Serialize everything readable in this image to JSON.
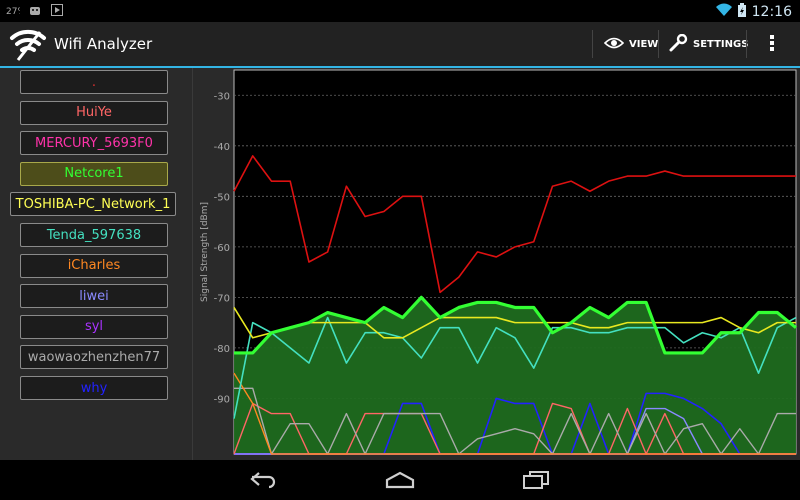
{
  "status_bar": {
    "icons": [
      "notification-icon",
      "android-icon",
      "play-icon"
    ],
    "time": "12:16"
  },
  "app": {
    "title": "Wifi Analyzer",
    "view_label": "VIEW",
    "settings_label": "SETTINGS"
  },
  "colors": {
    "accent": "#33b5e5",
    "selected_ap": "#4d4d1a"
  },
  "access_points": [
    {
      "name": ".",
      "color": "#e03030"
    },
    {
      "name": "HuiYe",
      "color": "#ff6666"
    },
    {
      "name": "MERCURY_5693F0",
      "color": "#ff33aa"
    },
    {
      "name": "Netcore1",
      "color": "#33ff33",
      "selected": true
    },
    {
      "name": "TOSHIBA-PC_Network_1",
      "color": "#ffff55"
    },
    {
      "name": "Tenda_597638",
      "color": "#44e0c0"
    },
    {
      "name": "iCharles",
      "color": "#ff8822"
    },
    {
      "name": "liwei",
      "color": "#8a8aff"
    },
    {
      "name": "syl",
      "color": "#aa33ff"
    },
    {
      "name": "waowaozhenzhen77",
      "color": "#aaaaaa"
    },
    {
      "name": "why",
      "color": "#2222ff"
    }
  ],
  "chart_data": {
    "type": "line",
    "ylabel": "Signal Strength [dBm]",
    "ylim": [
      -101,
      -25
    ],
    "yticks": [
      -30,
      -40,
      -50,
      -60,
      -70,
      -80,
      -90
    ],
    "ytick_labels": [
      "-30",
      "-40",
      "-50",
      "-60",
      "-70",
      "-80",
      "-90"
    ],
    "x": [
      0,
      1,
      2,
      3,
      4,
      5,
      6,
      7,
      8,
      9,
      10,
      11,
      12,
      13,
      14,
      15,
      16,
      17,
      18,
      19,
      20,
      21,
      22,
      23,
      24,
      25,
      26,
      27,
      28,
      29,
      30
    ],
    "series": [
      {
        "name": ".",
        "color": "#dd1111",
        "width": 1.6,
        "fill": false,
        "values": [
          -49,
          -42,
          -47,
          -47,
          -63,
          -61,
          -48,
          -54,
          -53,
          -50,
          -50,
          -69,
          -66,
          -61,
          -62,
          -60,
          -59,
          -48,
          -47,
          -49,
          -47,
          -46,
          -46,
          -45,
          -46,
          -46,
          -46,
          -46,
          -46,
          -46,
          -46
        ]
      },
      {
        "name": "Netcore1",
        "color": "#33ff33",
        "width": 3.2,
        "fill": true,
        "values": [
          -81,
          -81,
          -77,
          -76,
          -75,
          -73,
          -74,
          -75,
          -72,
          -74,
          -70,
          -74,
          -72,
          -71,
          -71,
          -72,
          -72,
          -77,
          -75,
          -72,
          -74,
          -71,
          -71,
          -81,
          -81,
          -81,
          -77,
          -77,
          -73,
          -73,
          -76
        ]
      },
      {
        "name": "TOSHIBA-PC_Network_1",
        "color": "#e8e820",
        "width": 1.6,
        "fill": false,
        "values": [
          -72,
          -78,
          -77,
          -76,
          -75,
          -75,
          -75,
          -75,
          -78,
          -78,
          -76,
          -74,
          -74,
          -74,
          -74,
          -75,
          -75,
          -75,
          -75,
          -76,
          -76,
          -75,
          -75,
          -75,
          -75,
          -75,
          -74,
          -76,
          -77,
          -75,
          -75
        ]
      },
      {
        "name": "Tenda_597638",
        "color": "#44e0c0",
        "width": 1.6,
        "fill": false,
        "values": [
          -94,
          -75,
          -77,
          -80,
          -83,
          -74,
          -83,
          -77,
          -77,
          -78,
          -82,
          -76,
          -76,
          -83,
          -76,
          -78,
          -84,
          -76,
          -76,
          -77,
          -77,
          -76,
          -76,
          -76,
          -79,
          -77,
          -78,
          -76,
          -85,
          -76,
          -74
        ]
      },
      {
        "name": "iCharles",
        "color": "#ff8822",
        "width": 1.4,
        "fill": false,
        "values": [
          -85,
          -91,
          -101,
          -101,
          -101,
          -101,
          -101,
          -101,
          -101,
          -101,
          -101,
          -101,
          -101,
          -101,
          -101,
          -101,
          -101,
          -101,
          -101,
          -101,
          -101,
          -101,
          -101,
          -101,
          -101,
          -101,
          -101,
          -101,
          -101,
          -101,
          -101
        ]
      },
      {
        "name": "waowaozhenzhen77",
        "color": "#aaaaaa",
        "width": 1.4,
        "fill": false,
        "values": [
          -88,
          -88,
          -101,
          -95,
          -95,
          -101,
          -93,
          -101,
          -93,
          -93,
          -93,
          -93,
          -101,
          -98,
          -97,
          -96,
          -97,
          -101,
          -93,
          -101,
          -93,
          -101,
          -93,
          -101,
          -96,
          -95,
          -101,
          -96,
          -101,
          -93,
          -93
        ]
      },
      {
        "name": "HuiYe",
        "color": "#ff6666",
        "width": 1.4,
        "fill": false,
        "values": [
          -101,
          -91,
          -93,
          -93,
          -101,
          -101,
          -101,
          -93,
          -93,
          -93,
          -93,
          -101,
          -101,
          -101,
          -101,
          -101,
          -101,
          -91,
          -92,
          -101,
          -101,
          -92,
          -101,
          -93,
          -101,
          -101,
          -101,
          -101,
          -101,
          -101,
          -101
        ]
      },
      {
        "name": "liwei",
        "color": "#8a8aff",
        "width": 1.4,
        "fill": false,
        "values": [
          -101,
          -101,
          -101,
          -101,
          -101,
          -101,
          -101,
          -101,
          -101,
          -101,
          -101,
          -101,
          -101,
          -101,
          -101,
          -101,
          -101,
          -101,
          -101,
          -101,
          -101,
          -101,
          -92,
          -92,
          -94,
          -101,
          -101,
          -101,
          -101,
          -101,
          -101
        ]
      },
      {
        "name": "why",
        "color": "#2222ff",
        "width": 1.6,
        "fill": false,
        "values": [
          -101,
          -101,
          -101,
          -101,
          -101,
          -101,
          -101,
          -101,
          -101,
          -91,
          -91,
          -101,
          -101,
          -101,
          -90,
          -91,
          -91,
          -101,
          -101,
          -91,
          -101,
          -101,
          -89,
          -89,
          -90,
          -92,
          -95,
          -101,
          -101,
          -101,
          -101
        ]
      },
      {
        "name": "MERCURY_5693F0",
        "color": "#ff33aa",
        "width": 1.4,
        "fill": false,
        "values": [
          -101,
          -101,
          -101,
          -101,
          -101,
          -101,
          -101,
          -101,
          -101,
          -101,
          -101,
          -101,
          -101,
          -101,
          -101,
          -101,
          -101,
          -101,
          -101,
          -101,
          -101,
          -101,
          -101,
          -101,
          -101,
          -101,
          -101,
          -101,
          -101,
          -101,
          -101
        ]
      },
      {
        "name": "syl",
        "color": "#aa33ff",
        "width": 1.4,
        "fill": false,
        "values": [
          -101,
          -101,
          -101,
          -101,
          -101,
          -101,
          -101,
          -101,
          -101,
          -101,
          -101,
          -101,
          -101,
          -101,
          -101,
          -101,
          -101,
          -101,
          -101,
          -101,
          -101,
          -101,
          -101,
          -101,
          -101,
          -101,
          -101,
          -101,
          -101,
          -101,
          -101
        ]
      }
    ]
  }
}
